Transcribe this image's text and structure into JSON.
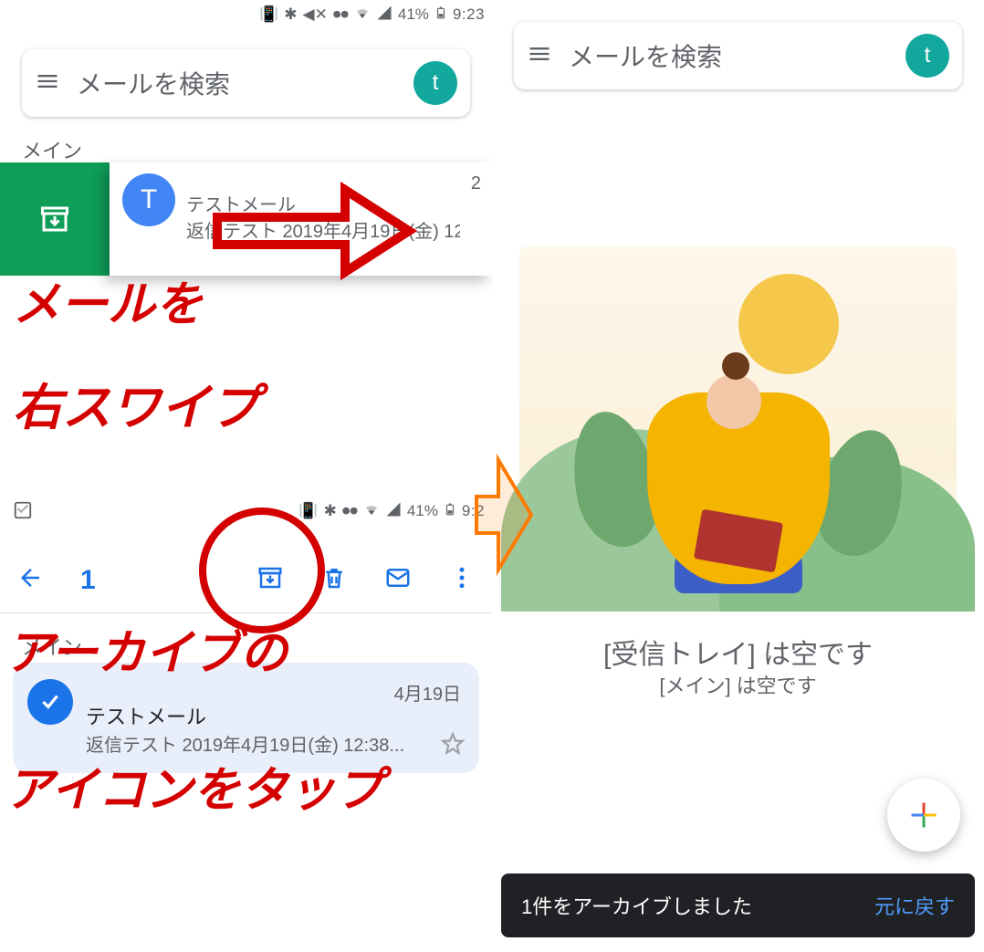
{
  "status": {
    "battery": "41%",
    "time": "9:23"
  },
  "search_placeholder": "メールを検索",
  "account_initial": "t",
  "pane_a": {
    "section": "メイン",
    "sender_initial": "T",
    "subject": "テストメール",
    "snippet": "返信テスト 2019年4月19日(金) 12",
    "count": "2"
  },
  "anno": {
    "line1": "メールを",
    "line2": "右スワイプ",
    "line3": "アーカイブの",
    "line4": "アイコンをタップ"
  },
  "pane_b": {
    "status_battery": "41%",
    "status_time": "9:2",
    "selected_count": "1",
    "section": "メイン",
    "date": "4月19日",
    "subject": "テストメール",
    "snippet": "返信テスト 2019年4月19日(金) 12:38..."
  },
  "pane_c": {
    "empty_title": "[受信トレイ] は空です",
    "empty_sub": "[メイン] は空です",
    "snackbar_msg": "1件をアーカイブしました",
    "snackbar_action": "元に戻す"
  }
}
